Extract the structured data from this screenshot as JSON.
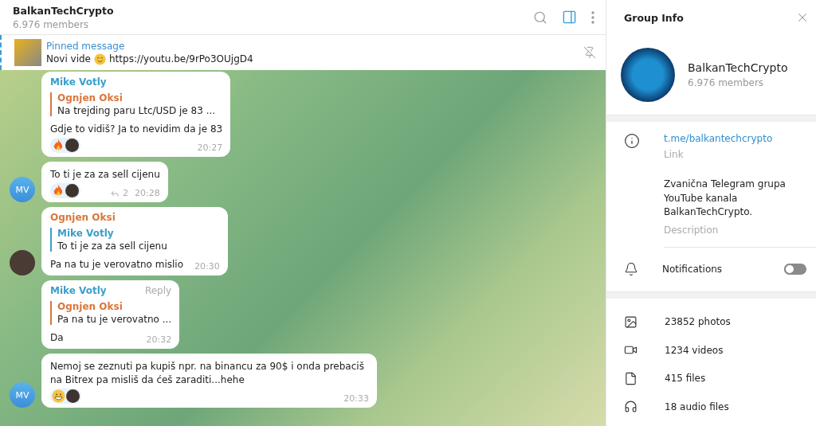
{
  "chat_header": {
    "title": "BalkanTechCrypto",
    "subtitle": "6.976 members",
    "sidebar_toggle_on": true
  },
  "pinned": {
    "label": "Pinned message",
    "text": "Novi vide",
    "link": "https://youtu.be/9rPo3OUjgD4"
  },
  "messages": [
    {
      "sender": "Mike Votly",
      "color": "#3a9fc9",
      "reply": {
        "name": "Ognjen Oksi",
        "color": "#d9773a",
        "text": "Na trejding paru Ltc/USD je 83 ..."
      },
      "text": "Gdje to vidiš? Ja to nevidim da je 83",
      "reactions": [
        {
          "kind": "fire"
        },
        {
          "kind": "avatar"
        }
      ],
      "time": "20:27"
    },
    {
      "text": "To ti je za za sell cijenu",
      "reactions": [
        {
          "kind": "fire"
        },
        {
          "kind": "avatar"
        }
      ],
      "replies": "2",
      "time": "20:28",
      "avatar": {
        "kind": "initials",
        "text": "MV"
      }
    },
    {
      "sender": "Ognjen Oksi",
      "color": "#d9773a",
      "reply": {
        "name": "Mike Votly",
        "color": "#3a9fc9",
        "text": "To ti je za za sell cijenu"
      },
      "text": "Pa na tu je verovatno mislio",
      "time": "20:30",
      "avatar": {
        "kind": "photo"
      }
    },
    {
      "sender": "Mike Votly",
      "color": "#3a9fc9",
      "action": "Reply",
      "reply": {
        "name": "Ognjen Oksi",
        "color": "#d9773a",
        "text": "Pa na tu je verovatno ..."
      },
      "text": "Da",
      "time": "20:32"
    },
    {
      "text": "Nemoj se zeznuti pa kupiš npr. na binancu za 90$ i onda prebaciš na Bitrex pa misliš da ćeš zaraditi...hehe",
      "reactions": [
        {
          "kind": "grin"
        },
        {
          "kind": "avatar"
        }
      ],
      "time": "20:33",
      "avatar": {
        "kind": "initials",
        "text": "MV"
      }
    }
  ],
  "group_info": {
    "title": "Group Info",
    "name": "BalkanTechCrypto",
    "members": "6.976 members",
    "link": "t.me/balkantechcrypto",
    "link_label": "Link",
    "description": "Zvanična Telegram grupa YouTube kanala BalkanTechCrypto.",
    "description_label": "Description",
    "notifications": {
      "label": "Notifications",
      "on": false
    },
    "media": [
      {
        "kind": "photos",
        "label": "23852 photos"
      },
      {
        "kind": "videos",
        "label": "1234 videos"
      },
      {
        "kind": "files",
        "label": "415 files"
      },
      {
        "kind": "audio",
        "label": "18 audio files"
      }
    ]
  }
}
